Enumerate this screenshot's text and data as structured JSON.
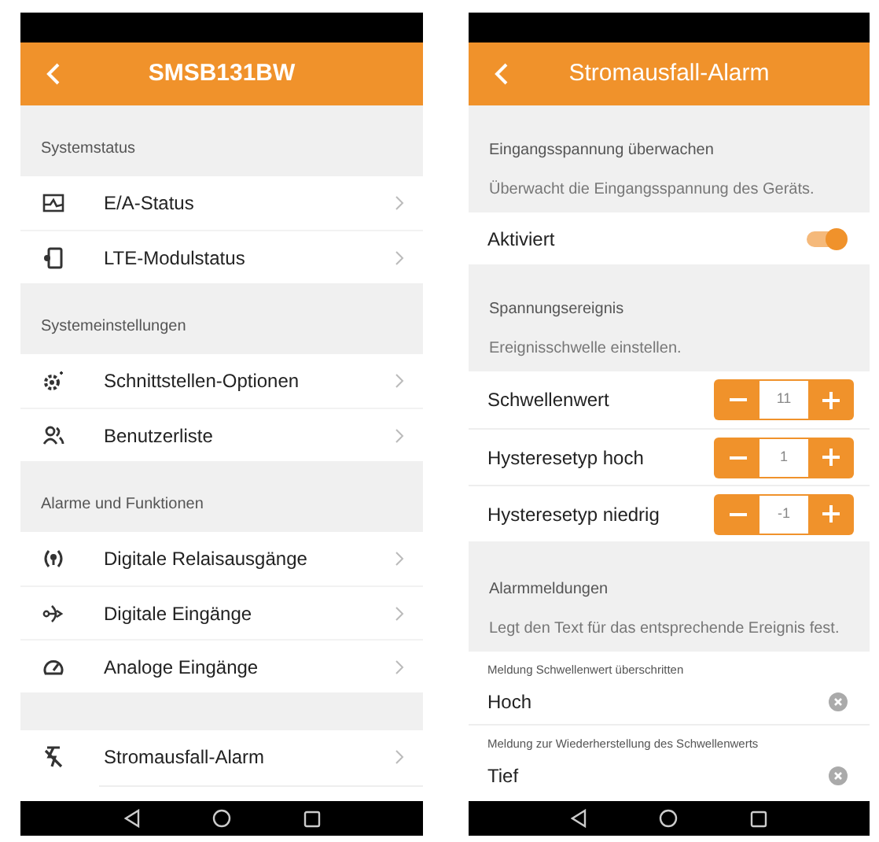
{
  "left_screen": {
    "title": "SMSB131BW",
    "sections": [
      {
        "header": "Systemstatus",
        "items": [
          {
            "label": "E/A-Status"
          },
          {
            "label": "LTE-Modulstatus"
          }
        ]
      },
      {
        "header": "Systemeinstellungen",
        "items": [
          {
            "label": "Schnittstellen-Optionen"
          },
          {
            "label": "Benutzerliste"
          }
        ]
      },
      {
        "header": "Alarme und Funktionen",
        "items": [
          {
            "label": "Digitale Relaisausgänge"
          },
          {
            "label": "Digitale Eingänge"
          },
          {
            "label": "Analoge Eingänge"
          }
        ]
      },
      {
        "items": [
          {
            "label": "Stromausfall-Alarm"
          }
        ]
      }
    ]
  },
  "right_screen": {
    "title": "Stromausfall-Alarm",
    "monitor": {
      "heading": "Eingangsspannung überwachen",
      "description": "Überwacht die Eingangsspannung des Geräts."
    },
    "toggle": {
      "label": "Aktiviert",
      "on": true
    },
    "event": {
      "heading": "Spannungsereignis",
      "description": "Ereignisschwelle einstellen."
    },
    "steppers": [
      {
        "label": "Schwellenwert",
        "value": "11"
      },
      {
        "label": "Hysteresetyp hoch",
        "value": "1"
      },
      {
        "label": "Hysteresetyp niedrig",
        "value": "-1"
      }
    ],
    "messages": {
      "heading": "Alarmmeldungen",
      "description": "Legt den Text für das entsprechende Ereignis fest."
    },
    "fields": [
      {
        "label": "Meldung Schwellenwert überschritten",
        "value": "Hoch"
      },
      {
        "label": "Meldung zur Wiederherstellung des Schwellenwerts",
        "value": "Tief"
      }
    ]
  }
}
